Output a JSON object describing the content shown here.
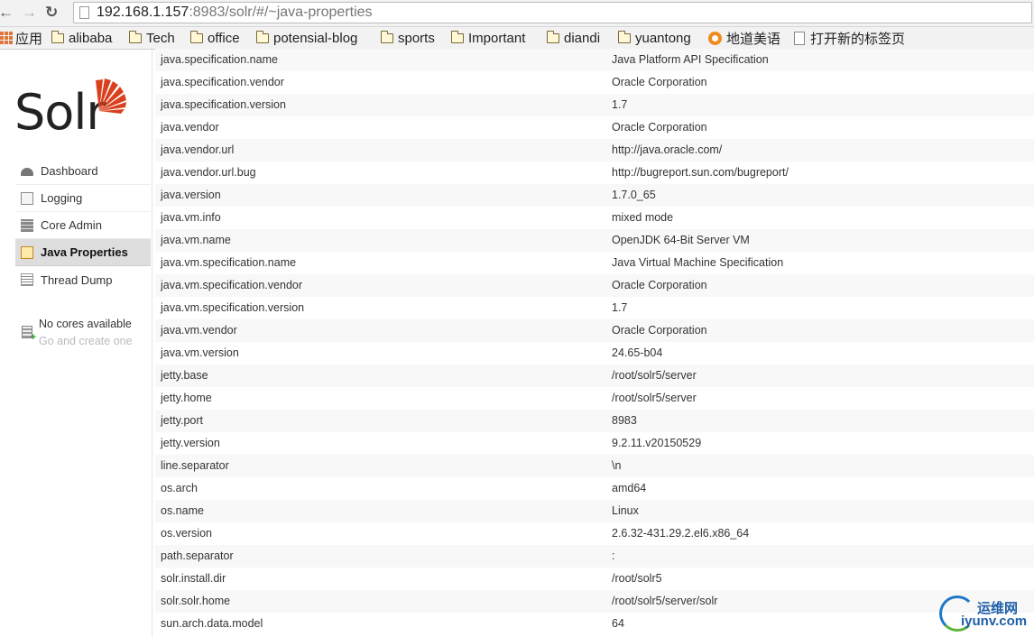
{
  "browser": {
    "url_host": "192.168.1.157",
    "url_rest": ":8983/solr/#/~java-properties",
    "bookmarks": [
      "应用",
      "alibaba",
      "Tech",
      "office",
      "potensial-blog",
      "sports",
      "Important",
      "diandi",
      "yuantong",
      "地道美语",
      "打开新的标签页"
    ]
  },
  "sidebar": {
    "logo_text": "Solr",
    "items": [
      "Dashboard",
      "Logging",
      "Core Admin",
      "Java Properties",
      "Thread Dump"
    ],
    "active_item": "Java Properties",
    "no_cores_label": "No cores available",
    "no_cores_link": "Go and create one"
  },
  "properties": [
    {
      "key": "java.specification.name",
      "value": "Java Platform API Specification"
    },
    {
      "key": "java.specification.vendor",
      "value": "Oracle Corporation"
    },
    {
      "key": "java.specification.version",
      "value": "1.7"
    },
    {
      "key": "java.vendor",
      "value": "Oracle Corporation"
    },
    {
      "key": "java.vendor.url",
      "value": "http://java.oracle.com/"
    },
    {
      "key": "java.vendor.url.bug",
      "value": "http://bugreport.sun.com/bugreport/"
    },
    {
      "key": "java.version",
      "value": "1.7.0_65"
    },
    {
      "key": "java.vm.info",
      "value": "mixed mode"
    },
    {
      "key": "java.vm.name",
      "value": "OpenJDK 64-Bit Server VM"
    },
    {
      "key": "java.vm.specification.name",
      "value": "Java Virtual Machine Specification"
    },
    {
      "key": "java.vm.specification.vendor",
      "value": "Oracle Corporation"
    },
    {
      "key": "java.vm.specification.version",
      "value": "1.7"
    },
    {
      "key": "java.vm.vendor",
      "value": "Oracle Corporation"
    },
    {
      "key": "java.vm.version",
      "value": "24.65-b04"
    },
    {
      "key": "jetty.base",
      "value": "/root/solr5/server"
    },
    {
      "key": "jetty.home",
      "value": "/root/solr5/server"
    },
    {
      "key": "jetty.port",
      "value": "8983"
    },
    {
      "key": "jetty.version",
      "value": "9.2.11.v20150529"
    },
    {
      "key": "line.separator",
      "value": "\\n"
    },
    {
      "key": "os.arch",
      "value": "amd64"
    },
    {
      "key": "os.name",
      "value": "Linux"
    },
    {
      "key": "os.version",
      "value": "2.6.32-431.29.2.el6.x86_64"
    },
    {
      "key": "path.separator",
      "value": ":"
    },
    {
      "key": "solr.install.dir",
      "value": "/root/solr5"
    },
    {
      "key": "solr.solr.home",
      "value": "/root/solr5/server/solr"
    },
    {
      "key": "sun.arch.data.model",
      "value": "64"
    }
  ],
  "watermark": {
    "line1": "运维网",
    "line2": "iyunv.com"
  },
  "colors": {
    "solr_orange": "#d9411e",
    "active_bg": "#dddddd",
    "row_alt": "#f8f8f8"
  }
}
